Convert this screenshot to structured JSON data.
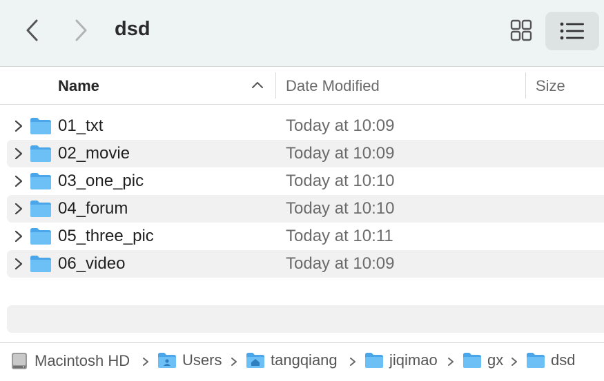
{
  "toolbar": {
    "title": "dsd",
    "back_icon": "chevron-left-icon",
    "forward_icon": "chevron-right-icon",
    "grid_view_icon": "grid-view-icon",
    "list_view_icon": "list-view-icon"
  },
  "columns": {
    "name": "Name",
    "date_modified": "Date Modified",
    "size": "Size",
    "sort": "ascending"
  },
  "rows": [
    {
      "name": "01_txt",
      "date": "Today at 10:09"
    },
    {
      "name": "02_movie",
      "date": "Today at 10:09"
    },
    {
      "name": "03_one_pic",
      "date": "Today at 10:10"
    },
    {
      "name": "04_forum",
      "date": "Today at 10:10"
    },
    {
      "name": "05_three_pic",
      "date": "Today at 10:11"
    },
    {
      "name": "06_video",
      "date": "Today at 10:09"
    }
  ],
  "pathbar": [
    {
      "label": "Macintosh HD",
      "icon": "hard-drive-icon"
    },
    {
      "label": "Users",
      "icon": "users-folder-icon"
    },
    {
      "label": "tangqiang",
      "icon": "home-folder-icon"
    },
    {
      "label": "jiqimao",
      "icon": "folder-icon"
    },
    {
      "label": "gx",
      "icon": "folder-icon"
    },
    {
      "label": "dsd",
      "icon": "folder-icon"
    }
  ],
  "colors": {
    "folder": "#5ab4f2",
    "toolbar_bg": "#eef3f3",
    "alt_row": "#f1f1f1"
  }
}
